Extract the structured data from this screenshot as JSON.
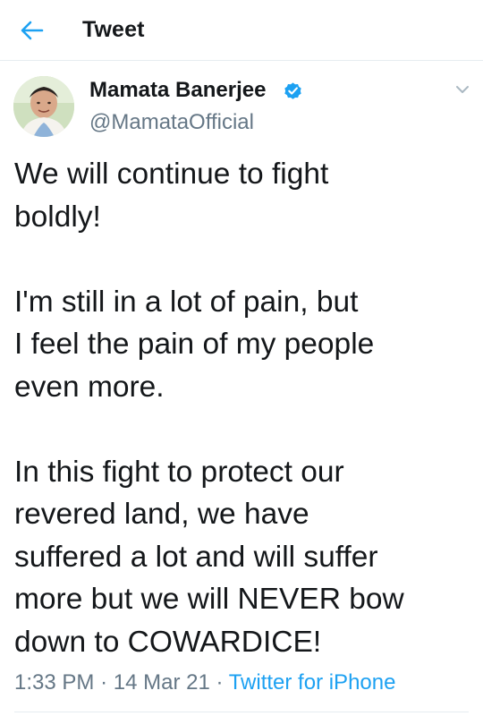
{
  "header": {
    "title": "Tweet",
    "back_icon": "arrow-left-icon"
  },
  "tweet": {
    "author": {
      "name": "Mamata Banerjee",
      "handle": "@MamataOfficial",
      "verified": true,
      "avatar": "profile-photo"
    },
    "paragraphs": [
      "We will continue to fight\nboldly!",
      "I'm still in a lot of pain, but\nI feel the pain of my people\neven more.",
      "In this fight to protect our\nrevered land, we have\nsuffered a lot and will suffer\nmore but we will NEVER bow\ndown to COWARDICE!"
    ],
    "time": "1:33 PM",
    "date": "14 Mar 21",
    "separator": "·",
    "source": "Twitter for iPhone"
  },
  "colors": {
    "accent": "#1da1f2",
    "text": "#14171a",
    "muted": "#657786",
    "divider": "#e6ecf0"
  }
}
